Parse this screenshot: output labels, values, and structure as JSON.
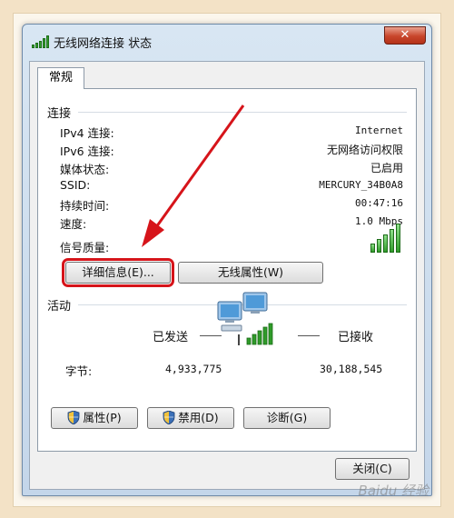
{
  "window": {
    "title": "无线网络连接 状态",
    "close_glyph": "✕"
  },
  "tabs": [
    "常规"
  ],
  "connection": {
    "group_label": "连接",
    "rows": [
      {
        "label": "IPv4 连接:",
        "value": "Internet"
      },
      {
        "label": "IPv6 连接:",
        "value": "无网络访问权限"
      },
      {
        "label": "媒体状态:",
        "value": "已启用"
      },
      {
        "label": "SSID:",
        "value": "MERCURY_34B0A8"
      },
      {
        "label": "持续时间:",
        "value": "00:47:16"
      },
      {
        "label": "速度:",
        "value": "1.0 Mbps"
      }
    ],
    "signal_label": "信号质量:",
    "signal_bars_filled": 5,
    "signal_bars_total": 5
  },
  "buttons": {
    "details": "详细信息(E)...",
    "wireless_props": "无线属性(W)"
  },
  "activity": {
    "group_label": "活动",
    "sent_label": "已发送",
    "received_label": "已接收",
    "bytes_label": "字节:",
    "bytes_sent": "4,933,775",
    "bytes_received": "30,188,545"
  },
  "actions": {
    "properties": "属性(P)",
    "disable": "禁用(D)",
    "diagnose": "诊断(G)",
    "close": "关闭(C)"
  },
  "watermark": "Baidu 经验",
  "colors": {
    "highlight": "#d6141a",
    "signal_green": "#2f9b29"
  },
  "icons": {
    "title": "wireless-signal-icon",
    "network": "network-computers-icon",
    "shield": "uac-shield-icon"
  }
}
